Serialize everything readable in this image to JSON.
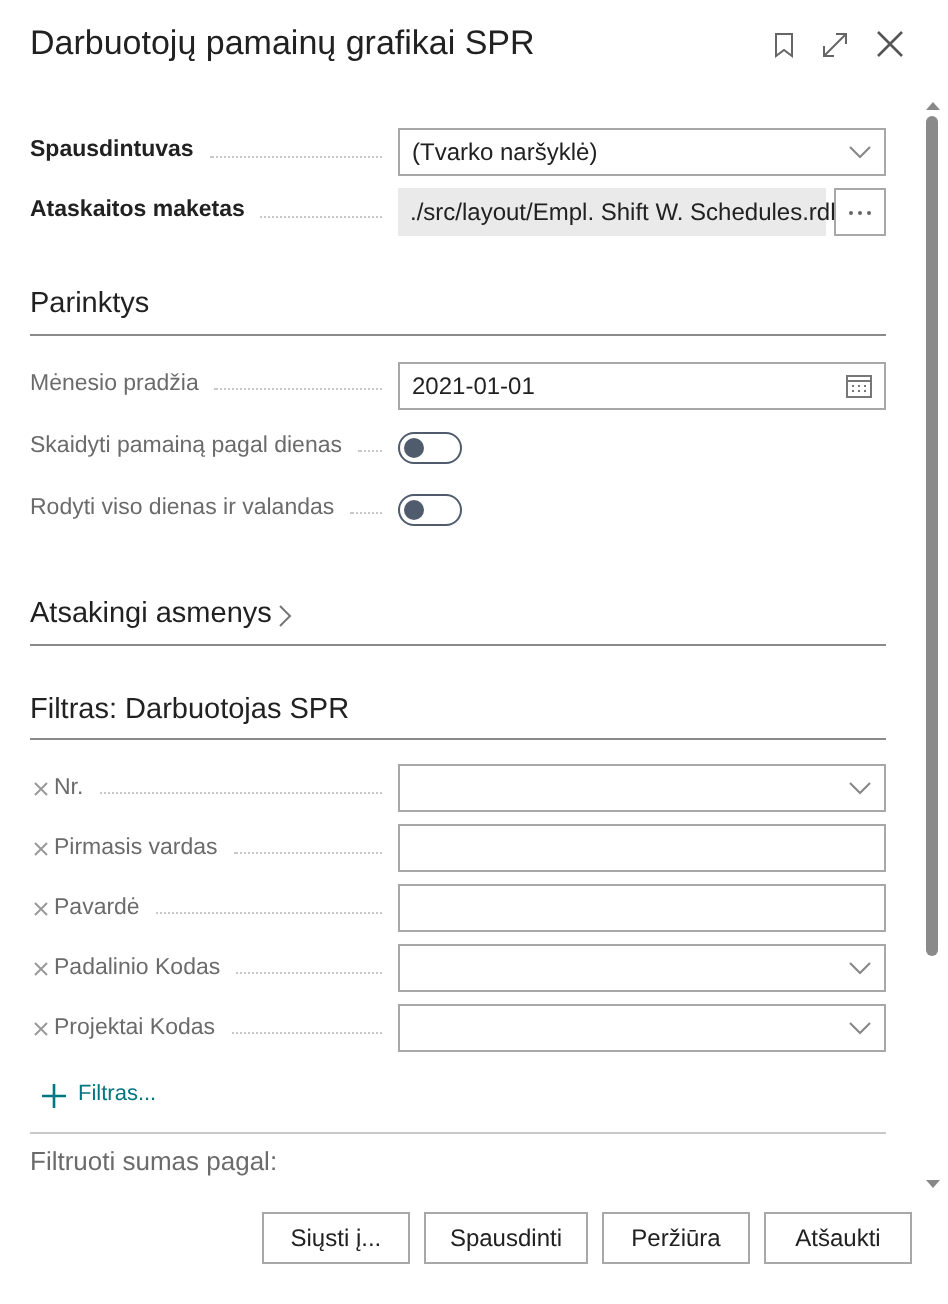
{
  "window": {
    "title": "Darbuotojų pamainų grafikai SPR"
  },
  "fields": [
    {
      "label": "Spausdintuvas",
      "kind": "select",
      "value": "(Tvarko naršyklė)"
    },
    {
      "label": "Ataskaitos maketas",
      "kind": "readonly",
      "value": "./src/layout/Empl. Shift W. Schedules.rdl"
    }
  ],
  "options": {
    "title": "Parinktys",
    "fields": [
      {
        "label": "Mėnesio pradžia",
        "kind": "date",
        "value": "2021-01-01"
      },
      {
        "label": "Skaidyti pamainą pagal dienas",
        "kind": "toggle",
        "on": false
      },
      {
        "label": "Rodyti viso dienas ir valandas",
        "kind": "toggle",
        "on": false
      }
    ]
  },
  "responsible": {
    "title": "Atsakingi asmenys",
    "expanded": false
  },
  "filter": {
    "title": "Filtras: Darbuotojas SPR",
    "fields": [
      {
        "label": "Nr.",
        "kind": "select"
      },
      {
        "label": "Pirmasis vardas",
        "kind": "text"
      },
      {
        "label": "Pavardė",
        "kind": "text"
      },
      {
        "label": "Padalinio Kodas",
        "kind": "select"
      },
      {
        "label": "Projektai Kodas",
        "kind": "select"
      }
    ],
    "add_label": "Filtras..."
  },
  "totals_filter": {
    "title": "Filtruoti sumas pagal:"
  },
  "buttons": [
    "Siųsti į...",
    "Spausdinti",
    "Peržiūra",
    "Atšaukti"
  ]
}
